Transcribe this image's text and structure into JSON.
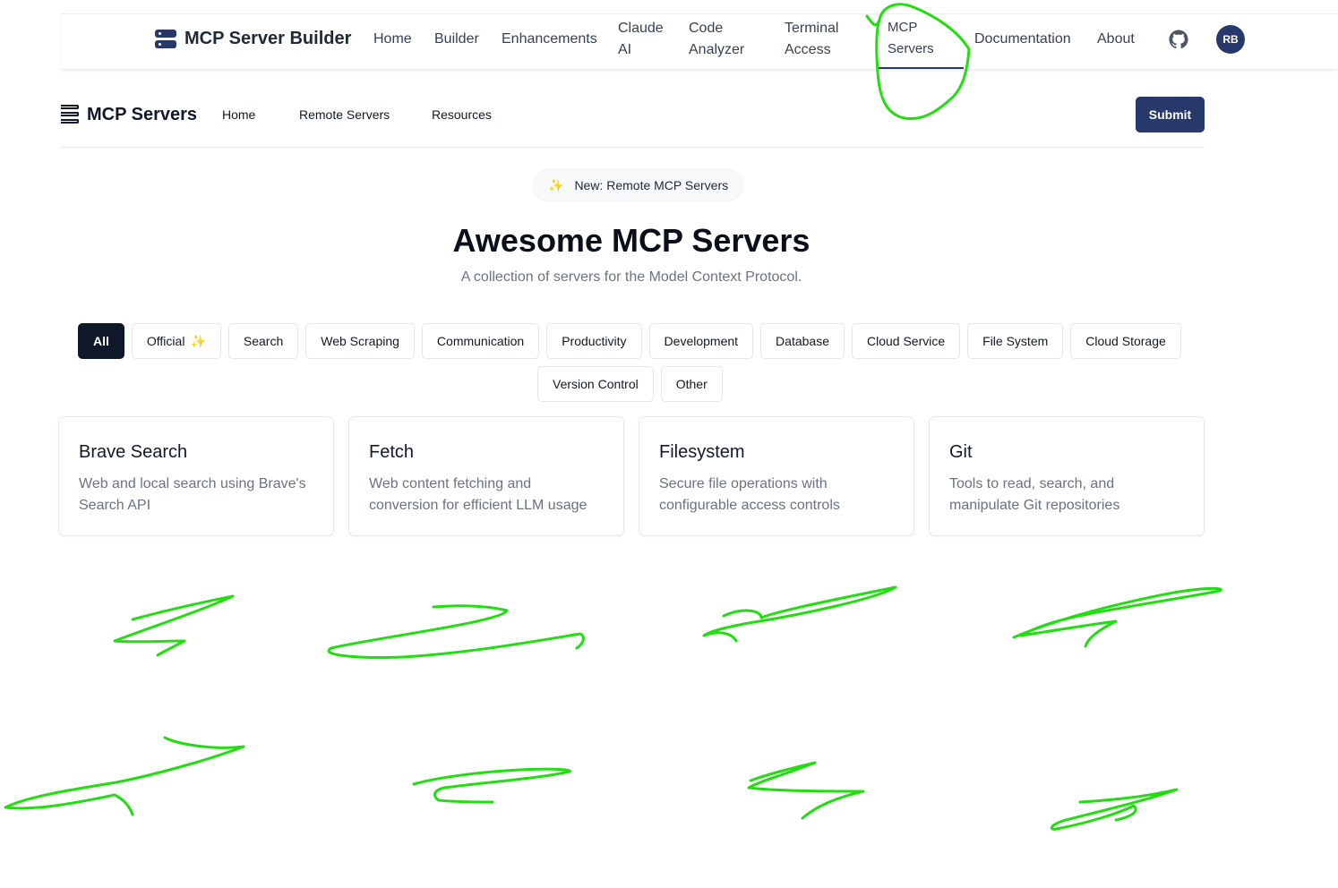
{
  "topbar": {
    "brand": "MCP Server Builder",
    "nav": [
      {
        "label": "Home"
      },
      {
        "label": "Builder"
      },
      {
        "label": "Enhancements"
      },
      {
        "label": "Claude\nAI"
      },
      {
        "label": "Code\nAnalyzer"
      },
      {
        "label": "Terminal\nAccess"
      },
      {
        "label": "MCP\nServers",
        "active": true
      },
      {
        "label": "Documentation"
      },
      {
        "label": "About"
      }
    ],
    "github_icon": "github-icon",
    "avatar_initials": "RB"
  },
  "subheader": {
    "title": "MCP Servers",
    "nav": [
      "Home",
      "Remote Servers",
      "Resources"
    ],
    "submit_label": "Submit"
  },
  "hero": {
    "badge": "New: Remote MCP Servers",
    "title": "Awesome MCP Servers",
    "subtitle": "A collection of servers for the Model Context Protocol."
  },
  "filters": {
    "active": "All",
    "row1": [
      "All",
      "Official",
      "Search",
      "Web Scraping",
      "Communication",
      "Productivity",
      "Development",
      "Database",
      "Cloud Service",
      "File System",
      "Cloud Storage"
    ],
    "row2": [
      "Version Control",
      "Other"
    ]
  },
  "servers": [
    {
      "name": "Brave Search",
      "description": "Web and local search using Brave's Search API"
    },
    {
      "name": "Fetch",
      "description": "Web content fetching and conversion for efficient LLM usage"
    },
    {
      "name": "Filesystem",
      "description": "Secure file operations with configurable access controls"
    },
    {
      "name": "Git",
      "description": "Tools to read, search, and manipulate Git repositories"
    }
  ],
  "colors": {
    "accent": "#27396b",
    "chip_active": "#0f172a",
    "annotation": "#22dd11",
    "sparkle": "#f5a524"
  }
}
